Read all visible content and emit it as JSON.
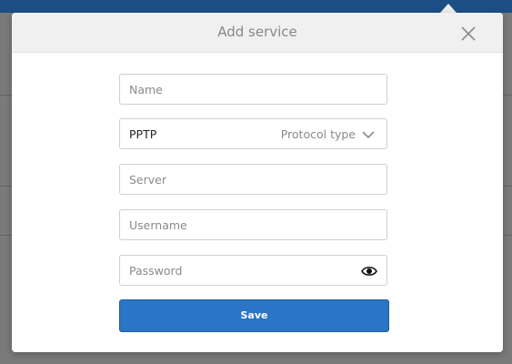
{
  "modal": {
    "title": "Add service"
  },
  "form": {
    "name": {
      "placeholder": "Name",
      "value": ""
    },
    "protocol": {
      "selected": "PPTP",
      "hint": "Protocol type"
    },
    "server": {
      "placeholder": "Server",
      "value": ""
    },
    "username": {
      "placeholder": "Username",
      "value": ""
    },
    "password": {
      "placeholder": "Password",
      "value": ""
    },
    "save_label": "Save"
  },
  "icons": {
    "close": "close-icon",
    "dropdown": "chevron-down-icon",
    "reveal": "eye-icon"
  },
  "colors": {
    "accent": "#2a75c5",
    "header_bg": "#f0f0f0",
    "topbar": "#1c4f86"
  }
}
